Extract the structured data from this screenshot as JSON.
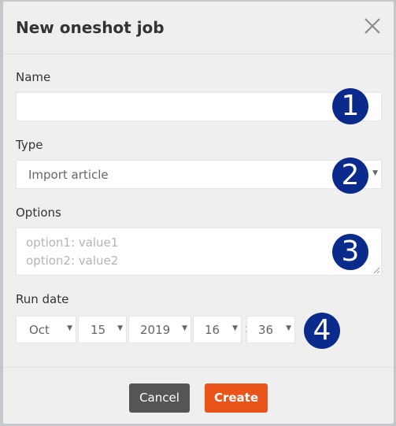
{
  "modal": {
    "title": "New oneshot job",
    "close_icon": "close-x-icon"
  },
  "form": {
    "name": {
      "label": "Name",
      "value": ""
    },
    "type": {
      "label": "Type",
      "selected": "Import article"
    },
    "options": {
      "label": "Options",
      "placeholder": "option1: value1\noption2: value2",
      "value": ""
    },
    "run_date": {
      "label": "Run date",
      "month": "Oct",
      "day": "15",
      "year": "2019",
      "hour": "16",
      "minute": "36",
      "separator": ":"
    }
  },
  "badges": [
    "1",
    "2",
    "3",
    "4"
  ],
  "footer": {
    "cancel_label": "Cancel",
    "create_label": "Create"
  },
  "colors": {
    "badge_bg": "#0a2a8c",
    "create_btn": "#e8541a",
    "cancel_btn": "#555555"
  }
}
